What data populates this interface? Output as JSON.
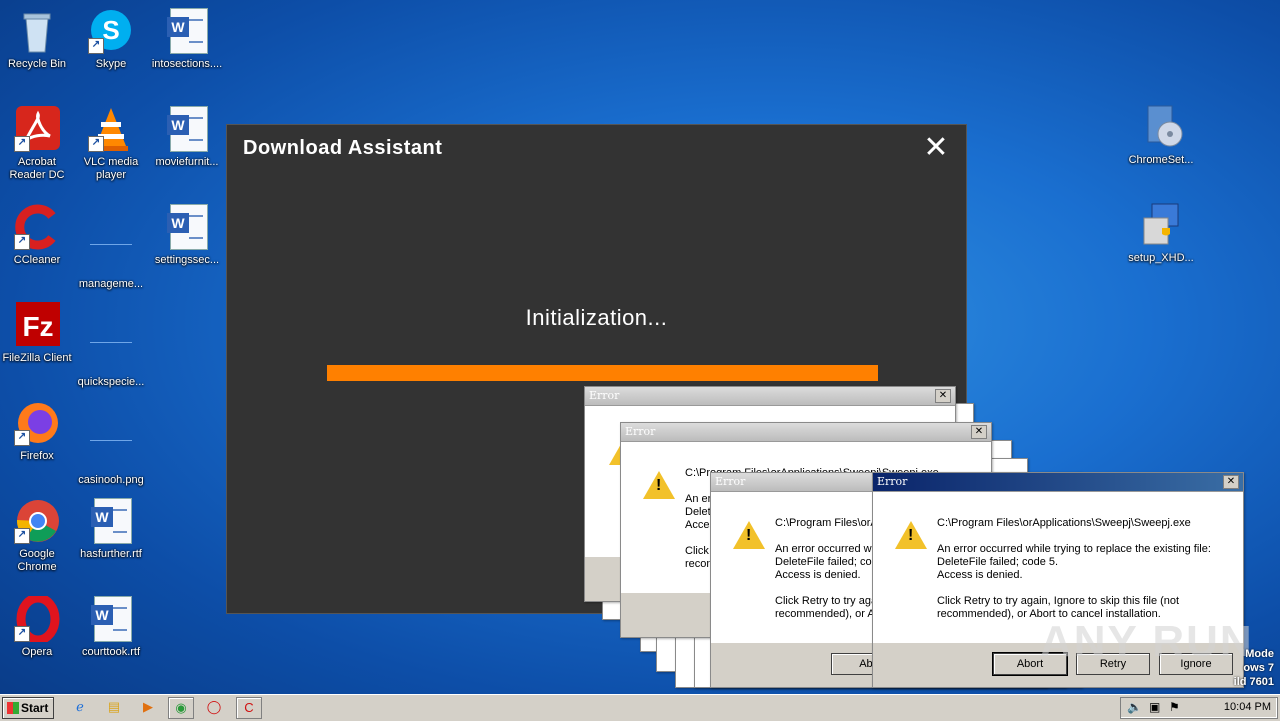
{
  "desktop": {
    "icons": [
      {
        "label": "Recycle Bin"
      },
      {
        "label": "Skype"
      },
      {
        "label": "intosections...."
      },
      {
        "label": "Acrobat Reader DC"
      },
      {
        "label": "VLC media player"
      },
      {
        "label": "moviefurnit..."
      },
      {
        "label": "CCleaner"
      },
      {
        "label": "manageme..."
      },
      {
        "label": "settingssec..."
      },
      {
        "label": "FileZilla Client"
      },
      {
        "label": "quickspecie..."
      },
      {
        "label": "Firefox"
      },
      {
        "label": "casinooh.png"
      },
      {
        "label": "Google Chrome"
      },
      {
        "label": "hasfurther.rtf"
      },
      {
        "label": "Opera"
      },
      {
        "label": "courttook.rtf"
      },
      {
        "label": "ChromeSet..."
      },
      {
        "label": "setup_XHD..."
      }
    ]
  },
  "download_assistant": {
    "title": "Download Assistant",
    "close": "✕",
    "status": "Initialization...",
    "progress": 1.0,
    "progress_color": "#ff8000"
  },
  "error": {
    "title": "Error",
    "close": "✕",
    "path": "C:\\Program Files\\orApplications\\Sweepj\\Sweepj.exe",
    "path_partial_1": "C:\\Program Files\\orApplications\\Sweepj\\Sweepj.exe",
    "path_partial_2": "C:\\Program Files\\orA",
    "line1": "An error occurred while trying to replace the existing file:",
    "line2": "DeleteFile failed; code 5.",
    "line3": "Access is denied.",
    "line4": "Click Retry to try again, Ignore to skip this file (not",
    "line5": "recommended), or Abort to cancel installation.",
    "p_an_er": "An er",
    "p_delet": "Delet",
    "p_acces": "Acces",
    "p_click": "Click I",
    "p_recon": "recon",
    "p2_1": "An error occurred wh",
    "p2_2": "DeleteFile failed; coc",
    "p2_3": "Access is denied.",
    "p2_4": "Click Retry to try agai",
    "p2_5": "recommended), or A",
    "abort": "Abort",
    "retry": "Retry",
    "ignore": "Ignore",
    "abo_partial": "Abo"
  },
  "watermark": "ANY RUN",
  "test_mode": {
    "line1": "Mode",
    "line2": "ows 7",
    "line3": "ild 7601"
  },
  "taskbar": {
    "start": "Start",
    "clock": "10:04 PM"
  }
}
